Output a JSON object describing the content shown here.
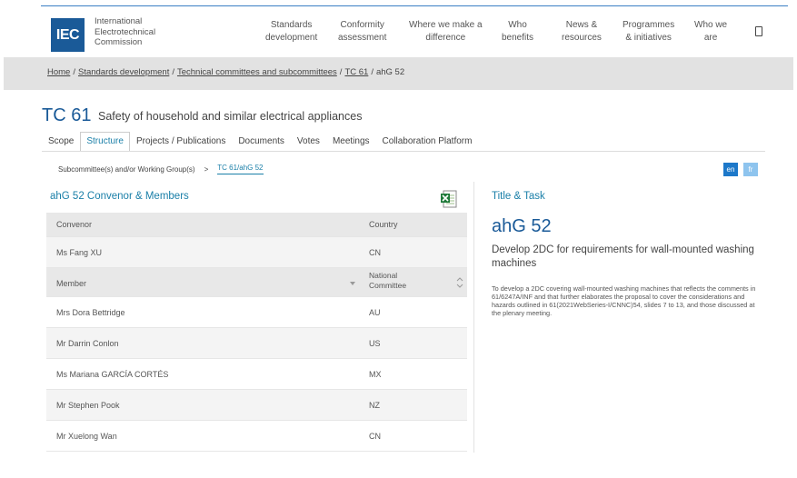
{
  "header": {
    "logo": "IEC",
    "org_name": [
      "International",
      "Electrotechnical",
      "Commission"
    ],
    "nav": [
      {
        "line1": "Standards",
        "line2": "development"
      },
      {
        "line1": "Conformity",
        "line2": "assessment"
      },
      {
        "line1": "Where we make a",
        "line2": "difference"
      },
      {
        "line1": "Who",
        "line2": "benefits"
      },
      {
        "line1": "News &",
        "line2": "resources"
      },
      {
        "line1": "Programmes",
        "line2": "& initiatives"
      },
      {
        "line1": "Who we",
        "line2": "are"
      }
    ]
  },
  "breadcrumb": {
    "items": [
      "Home",
      "Standards development",
      "Technical committees and subcommittees",
      "TC 61"
    ],
    "current": "ahG 52"
  },
  "page": {
    "code": "TC 61",
    "name": "Safety of household and similar electrical appliances"
  },
  "tabs": [
    "Scope",
    "Structure",
    "Projects / Publications",
    "Documents",
    "Votes",
    "Meetings",
    "Collaboration Platform"
  ],
  "active_tab": "Structure",
  "subnav": {
    "parent": "Subcommittee(s) and/or Working Group(s)",
    "sep": ">",
    "current": "TC 61/ahG 52"
  },
  "languages": [
    "en",
    "fr"
  ],
  "left_panel": {
    "title": "ahG 52 Convenor & Members",
    "convenor_header": {
      "name": "Convenor",
      "country": "Country"
    },
    "convenor": {
      "name": "Ms Fang XU",
      "country": "CN"
    },
    "member_header": {
      "name": "Member",
      "country": "National Committee"
    },
    "members": [
      {
        "name": "Mrs Dora Bettridge",
        "country": "AU"
      },
      {
        "name": "Mr Darrin Conlon",
        "country": "US"
      },
      {
        "name": "Ms Mariana GARCÍA CORTÉS",
        "country": "MX"
      },
      {
        "name": "Mr Stephen Pook",
        "country": "NZ"
      },
      {
        "name": "Mr Xuelong Wan",
        "country": "CN"
      }
    ]
  },
  "right_panel": {
    "label": "Title & Task",
    "title": "ahG 52",
    "subtitle": "Develop 2DC for requirements for wall-mounted washing machines",
    "description": "To develop a 2DC covering wall-mounted washing machines that reflects the comments in 61/6247A/INF and that further elaborates the proposal to cover the considerations and hazards outlined in 61(2021WebSeries-I/CNNC)54, slides 7 to 13, and those discussed at the plenary meeting."
  },
  "colors": {
    "brand": "#1a5a98",
    "accent": "#1a7fa8",
    "lang_en": "#1d78c9",
    "lang_fr": "#8ec4ee"
  },
  "icons": {
    "menu": "menu-icon",
    "export": "excel-icon"
  }
}
